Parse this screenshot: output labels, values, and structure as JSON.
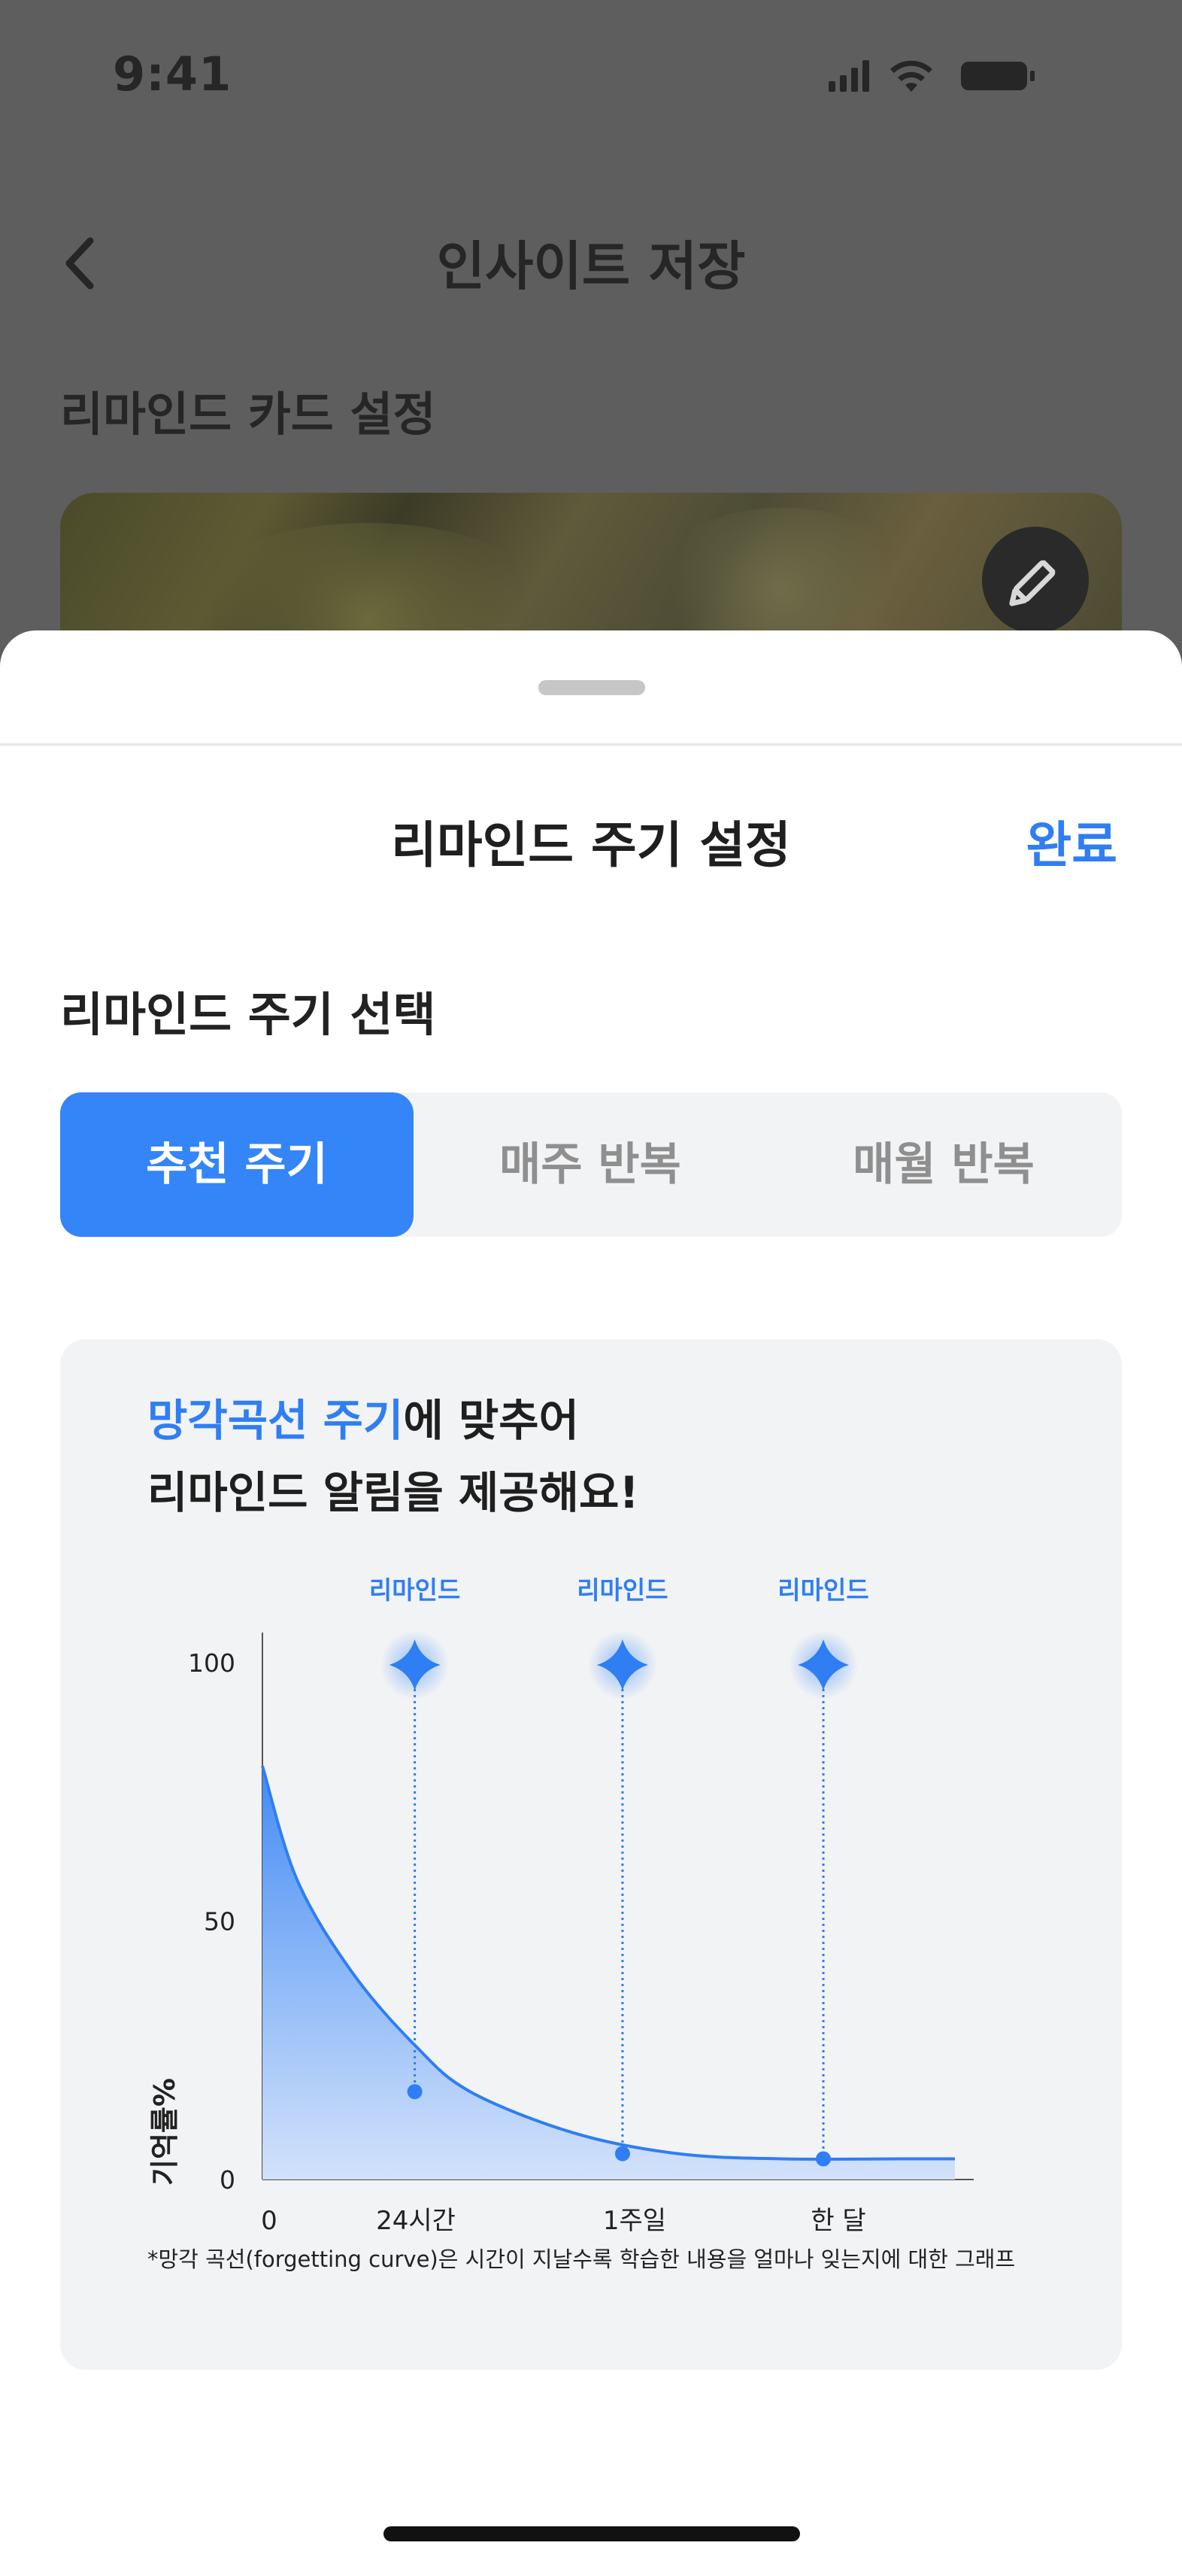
{
  "status_bar": {
    "time": "9:41"
  },
  "background_screen": {
    "title": "인사이트 저장",
    "section_title": "리마인드 카드 설정"
  },
  "sheet": {
    "title": "리마인드 주기 설정",
    "done_label": "완료",
    "section_label": "리마인드 주기 선택",
    "options": [
      {
        "label": "추천 주기",
        "selected": true
      },
      {
        "label": "매주 반복",
        "selected": false
      },
      {
        "label": "매월 반복",
        "selected": false
      }
    ],
    "info": {
      "headline_highlight": "망각곡선 주기",
      "headline_rest_line1": "에 맞추어",
      "headline_line2": "리마인드 알림을 제공해요!",
      "footnote": "*망각 곡선(forgetting curve)은 시간이 지날수록 학습한 내용을 얼마나 잊는지에 대한 그래프"
    }
  },
  "colors": {
    "accent": "#2f7ef3",
    "selected_segment": "#3485f7",
    "card_bg": "#f2f3f5"
  },
  "chart_data": {
    "type": "area",
    "ylabel": "기억률%",
    "y_ticks": [
      "100",
      "50",
      "0"
    ],
    "ylim": [
      0,
      100
    ],
    "x_ticks": [
      "0",
      "24시간",
      "1주일",
      "한 달"
    ],
    "curve": [
      {
        "x": 0,
        "y": 80
      },
      {
        "x": 0.05,
        "y": 58
      },
      {
        "x": 0.13,
        "y": 40
      },
      {
        "x": 0.22,
        "y": 26
      },
      {
        "x": 0.3,
        "y": 17
      },
      {
        "x": 0.45,
        "y": 9
      },
      {
        "x": 0.6,
        "y": 5
      },
      {
        "x": 0.75,
        "y": 4
      },
      {
        "x": 0.92,
        "y": 4
      },
      {
        "x": 1.0,
        "y": 4
      }
    ],
    "reminders": [
      {
        "x": 0.22,
        "y": 17,
        "label": "리마인드"
      },
      {
        "x": 0.52,
        "y": 5,
        "label": "리마인드"
      },
      {
        "x": 0.81,
        "y": 4,
        "label": "리마인드"
      }
    ],
    "legend": "none",
    "grid": false
  }
}
